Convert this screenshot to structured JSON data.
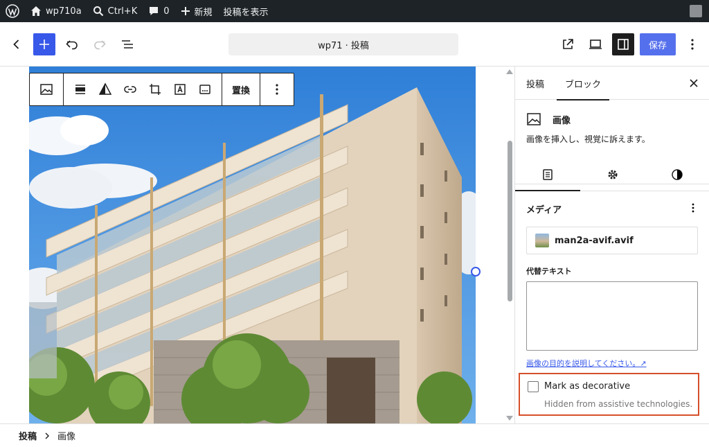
{
  "admin_bar": {
    "site_name": "wp710a",
    "search_shortcut": "Ctrl+K",
    "comments_count": "0",
    "new_label": "新規",
    "view_post_label": "投稿を表示"
  },
  "header": {
    "document_title": "wp71 · 投稿",
    "save_label": "保存"
  },
  "block_toolbar": {
    "replace_label": "置換"
  },
  "sidebar": {
    "tabs": [
      {
        "label": "投稿"
      },
      {
        "label": "ブロック"
      }
    ],
    "block_card": {
      "title": "画像",
      "description": "画像を挿入し、視覚に訴えます。"
    },
    "media_panel": {
      "title": "メディア",
      "file_name": "man2a-avif.avif",
      "alt_label": "代替テキスト",
      "alt_value": "",
      "alt_help_link": "画像の目的を説明してください。↗",
      "decorative_label": "Mark as decorative",
      "decorative_help": "Hidden from assistive technologies."
    }
  },
  "footer": {
    "breadcrumb_root": "投稿",
    "breadcrumb_current": "画像"
  },
  "colors": {
    "accent": "#3858e9",
    "admin_bar": "#1d2327",
    "highlight_border": "#d54f2a"
  }
}
